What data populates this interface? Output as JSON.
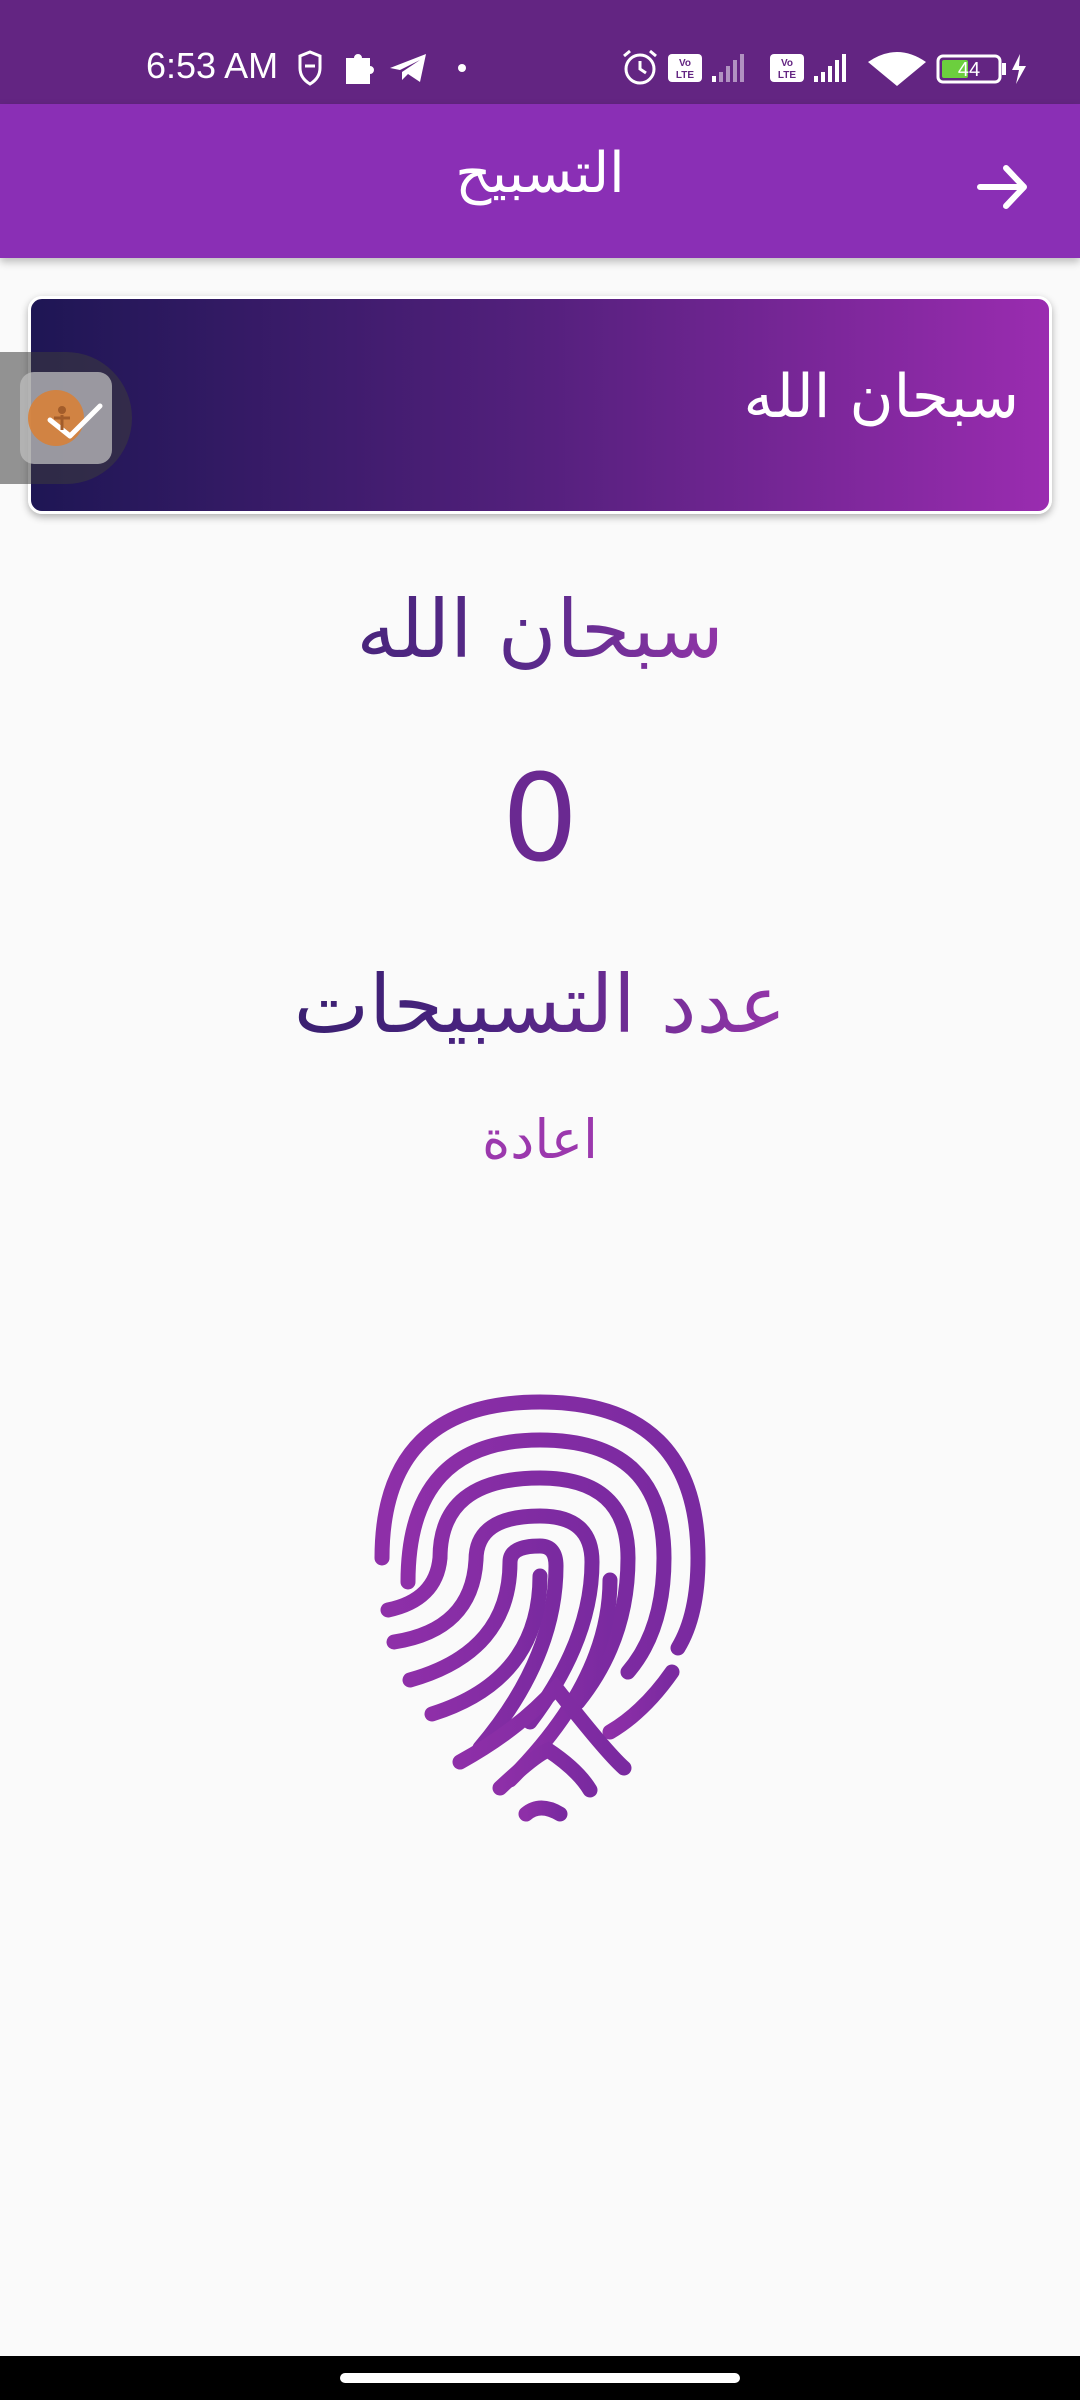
{
  "status_bar": {
    "time": "6:53 AM",
    "battery_level": "44",
    "icons": [
      "alarm-icon",
      "volte-icon",
      "signal-icon",
      "volte-icon",
      "signal-icon",
      "wifi-icon",
      "battery-icon",
      "charging-icon"
    ],
    "left_icons": [
      "shield-icon",
      "puzzle-icon",
      "telegram-icon",
      "dot-icon"
    ]
  },
  "app_bar": {
    "title": "التسبيح",
    "back_icon": "arrow-right-icon"
  },
  "dhikr_card": {
    "label": "سبحان الله"
  },
  "main": {
    "dhikr_text": "سبحان الله",
    "count": "0",
    "count_label": "عدد التسبيحات",
    "reset_label": "اعادة",
    "tap_icon": "fingerprint-icon"
  },
  "colors": {
    "status_bar": "#632582",
    "app_bar": "#8a2fb5",
    "accent": "#9b38ad",
    "dark": "#1e1654",
    "background": "#fafafa"
  }
}
